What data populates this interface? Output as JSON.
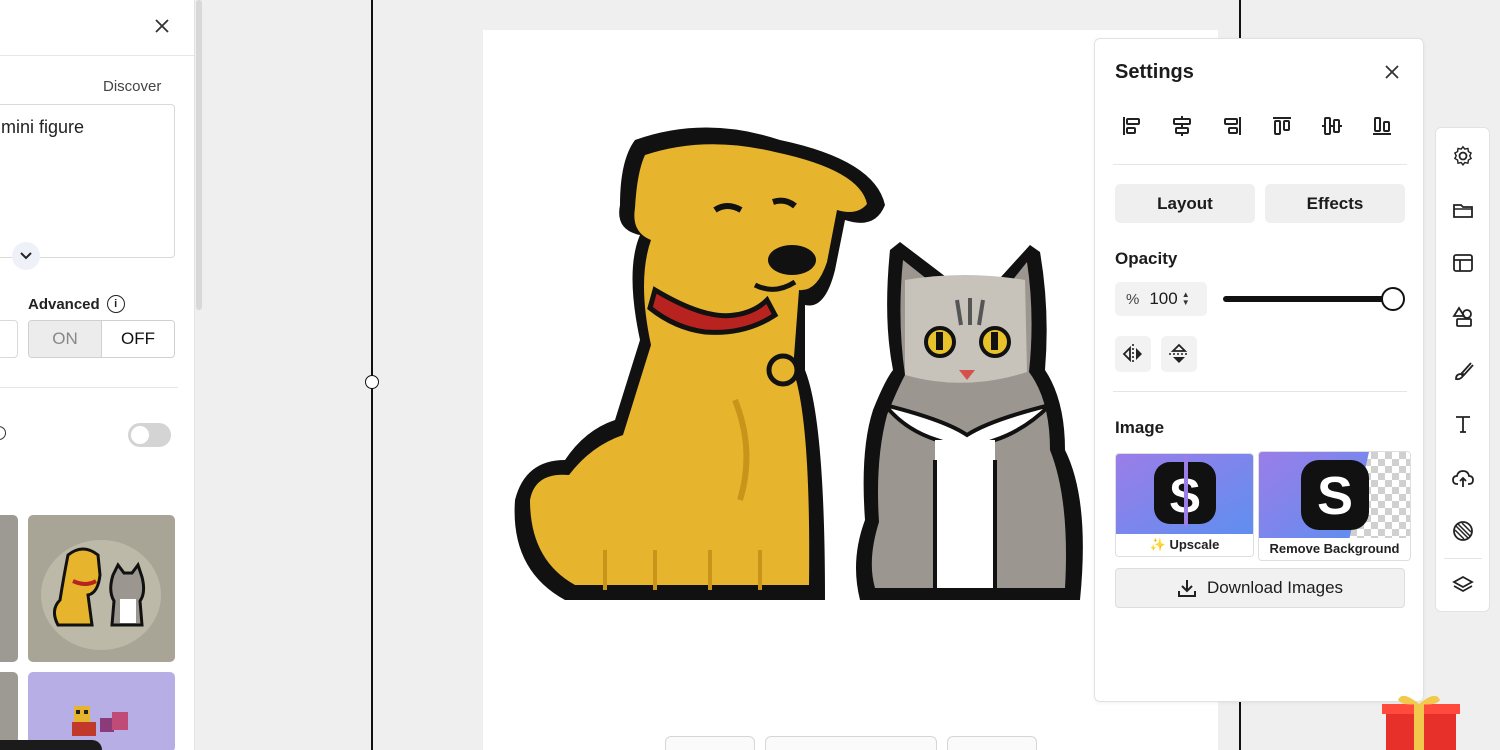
{
  "left_panel": {
    "discover_label": "Discover",
    "prompt_text": "mini figure",
    "advanced_label": "Advanced",
    "info_glyph": "i",
    "toggle_on": "ON",
    "toggle_off": "OFF"
  },
  "settings": {
    "title": "Settings",
    "tabs": [
      "Layout",
      "Effects"
    ],
    "opacity_label": "Opacity",
    "opacity_unit": "%",
    "opacity_value": "100",
    "opacity_fraction": 1.0,
    "image_label": "Image",
    "upscale_label": "Upscale",
    "upscale_sparkle": "✨",
    "remove_bg_label": "Remove Background",
    "download_label": "Download Images"
  },
  "icons": {
    "left_close": "close-icon",
    "settings_close": "close-icon",
    "align": [
      "align-left-icon",
      "align-center-horizontal-icon",
      "align-right-icon",
      "align-top-icon",
      "align-center-vertical-icon",
      "align-bottom-icon"
    ],
    "flip": [
      "flip-horizontal-icon",
      "flip-vertical-icon"
    ],
    "toolbar": [
      "gear-icon",
      "folder-icon",
      "layout-icon",
      "shapes-icon",
      "brush-icon",
      "text-icon",
      "cloud-upload-icon",
      "pattern-icon",
      "layers-icon"
    ]
  },
  "colors": {
    "accent": "#111111",
    "panel_bg": "#ffffff",
    "canvas_bg": "#efefef",
    "dog": "#e7b52d",
    "cat": "#8f8a84"
  }
}
